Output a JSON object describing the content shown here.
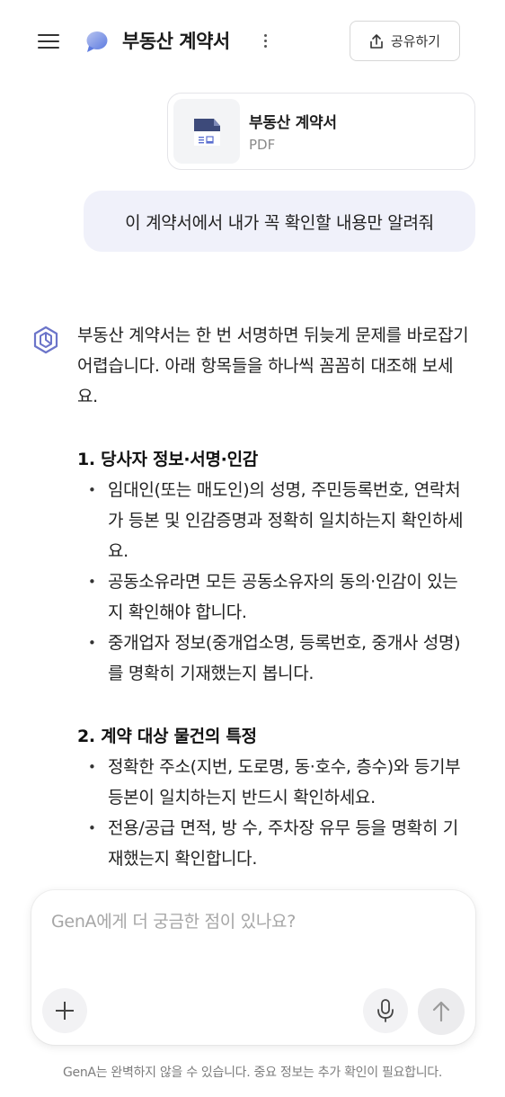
{
  "header": {
    "title": "부동산 계약서",
    "share_label": "공유하기"
  },
  "file_card": {
    "name": "부동산 계약서",
    "type": "PDF"
  },
  "user_message": "이 계약서에서 내가 꼭 확인할 내용만 알려줘",
  "answer": {
    "intro": "부동산 계약서는 한 번 서명하면 뒤늦게 문제를 바로잡기 어렵습니다. 아래 항목들을 하나씩 꼼꼼히 대조해 보세요.",
    "sections": [
      {
        "heading": "1. 당사자 정보·서명·인감",
        "items": [
          "임대인(또는 매도인)의 성명, 주민등록번호, 연락처가 등본 및 인감증명과 정확히 일치하는지 확인하세요.",
          "공동소유라면 모든 공동소유자의 동의·인감이 있는지 확인해야 합니다.",
          "중개업자 정보(중개업소명, 등록번호, 중개사 성명)를 명확히 기재했는지 봅니다."
        ]
      },
      {
        "heading": "2. 계약 대상 물건의 특정",
        "items": [
          "정확한 주소(지번, 도로명, 동·호수, 층수)와 등기부등본이 일치하는지 반드시 확인하세요.",
          "전용/공급 면적, 방 수, 주차장 유무 등을 명확히 기재했는지 확인합니다."
        ]
      }
    ]
  },
  "composer": {
    "placeholder": "GenA에게 더 궁금한 점이 있나요?"
  },
  "disclaimer": "GenA는 완벽하지 않을 수 있습니다. 중요 정보는 추가 확인이 필요합니다.",
  "colors": {
    "accent": "#6b74c9",
    "user_bubble": "#f0f1fa",
    "file_icon": "#3d4a7a"
  }
}
